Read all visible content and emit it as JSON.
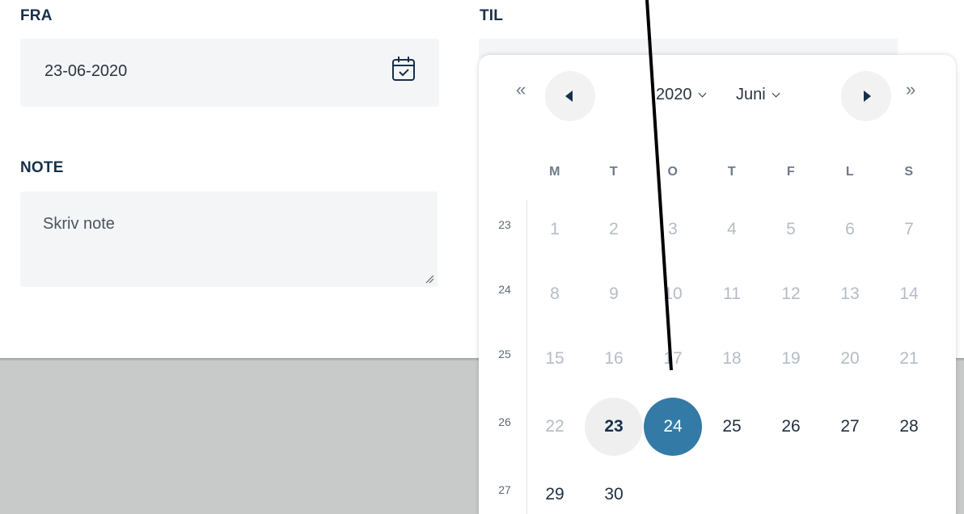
{
  "form": {
    "from_label": "FRA",
    "from_value": "23-06-2020",
    "to_label": "TIL",
    "note_label": "NOTE",
    "note_placeholder": "Skriv note"
  },
  "calendar": {
    "prev_year_glyph": "«",
    "next_year_glyph": "»",
    "year": "2020",
    "month": "Juni",
    "weekdays": [
      "M",
      "T",
      "O",
      "T",
      "F",
      "L",
      "S"
    ],
    "weeks": [
      {
        "week": "23",
        "days": [
          {
            "d": "1",
            "s": "muted"
          },
          {
            "d": "2",
            "s": "muted"
          },
          {
            "d": "3",
            "s": "muted"
          },
          {
            "d": "4",
            "s": "muted"
          },
          {
            "d": "5",
            "s": "muted"
          },
          {
            "d": "6",
            "s": "muted"
          },
          {
            "d": "7",
            "s": "muted"
          }
        ]
      },
      {
        "week": "24",
        "days": [
          {
            "d": "8",
            "s": "muted"
          },
          {
            "d": "9",
            "s": "muted"
          },
          {
            "d": "10",
            "s": "muted"
          },
          {
            "d": "11",
            "s": "muted"
          },
          {
            "d": "12",
            "s": "muted"
          },
          {
            "d": "13",
            "s": "muted"
          },
          {
            "d": "14",
            "s": "muted"
          }
        ]
      },
      {
        "week": "25",
        "days": [
          {
            "d": "15",
            "s": "muted"
          },
          {
            "d": "16",
            "s": "muted"
          },
          {
            "d": "17",
            "s": "muted"
          },
          {
            "d": "18",
            "s": "muted"
          },
          {
            "d": "19",
            "s": "muted"
          },
          {
            "d": "20",
            "s": "muted"
          },
          {
            "d": "21",
            "s": "muted"
          }
        ]
      },
      {
        "week": "26",
        "days": [
          {
            "d": "22",
            "s": "muted"
          },
          {
            "d": "23",
            "s": "today"
          },
          {
            "d": "24",
            "s": "selected"
          },
          {
            "d": "25",
            "s": "normal"
          },
          {
            "d": "26",
            "s": "normal"
          },
          {
            "d": "27",
            "s": "normal"
          },
          {
            "d": "28",
            "s": "normal"
          }
        ]
      },
      {
        "week": "27",
        "days": [
          {
            "d": "29",
            "s": "normal"
          },
          {
            "d": "30",
            "s": "normal"
          }
        ]
      }
    ]
  },
  "colors": {
    "accent_selected": "#337aa6",
    "label_text": "#16304a",
    "muted_day": "#b5bcc4",
    "field_bg": "#f4f5f7",
    "overlay_gray": "#c8c9c9"
  },
  "icons": {
    "from_field_icon": "calendar-check-icon",
    "prev_year": "double-chevron-left-icon",
    "prev_month": "caret-left-icon",
    "next_month": "caret-right-icon",
    "next_year": "double-chevron-right-icon"
  }
}
